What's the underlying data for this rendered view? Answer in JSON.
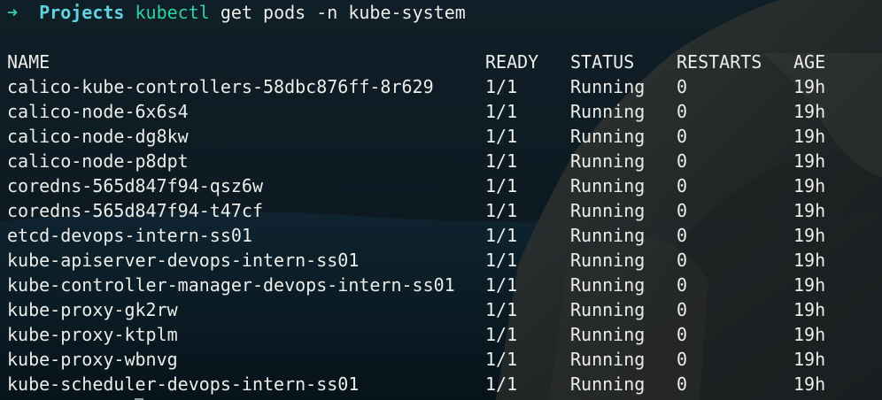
{
  "prompt": {
    "arrow": "➜",
    "directory": "Projects",
    "command": "kubectl",
    "args": "get pods -n kube-system"
  },
  "table": {
    "headers": {
      "name": "NAME",
      "ready": "READY",
      "status": "STATUS",
      "restarts": "RESTARTS",
      "age": "AGE"
    },
    "rows": [
      {
        "name": "calico-kube-controllers-58dbc876ff-8r629",
        "ready": "1/1",
        "status": "Running",
        "restarts": "0",
        "age": "19h"
      },
      {
        "name": "calico-node-6x6s4",
        "ready": "1/1",
        "status": "Running",
        "restarts": "0",
        "age": "19h"
      },
      {
        "name": "calico-node-dg8kw",
        "ready": "1/1",
        "status": "Running",
        "restarts": "0",
        "age": "19h"
      },
      {
        "name": "calico-node-p8dpt",
        "ready": "1/1",
        "status": "Running",
        "restarts": "0",
        "age": "19h"
      },
      {
        "name": "coredns-565d847f94-qsz6w",
        "ready": "1/1",
        "status": "Running",
        "restarts": "0",
        "age": "19h"
      },
      {
        "name": "coredns-565d847f94-t47cf",
        "ready": "1/1",
        "status": "Running",
        "restarts": "0",
        "age": "19h"
      },
      {
        "name": "etcd-devops-intern-ss01",
        "ready": "1/1",
        "status": "Running",
        "restarts": "0",
        "age": "19h"
      },
      {
        "name": "kube-apiserver-devops-intern-ss01",
        "ready": "1/1",
        "status": "Running",
        "restarts": "0",
        "age": "19h"
      },
      {
        "name": "kube-controller-manager-devops-intern-ss01",
        "ready": "1/1",
        "status": "Running",
        "restarts": "0",
        "age": "19h"
      },
      {
        "name": "kube-proxy-gk2rw",
        "ready": "1/1",
        "status": "Running",
        "restarts": "0",
        "age": "19h"
      },
      {
        "name": "kube-proxy-ktplm",
        "ready": "1/1",
        "status": "Running",
        "restarts": "0",
        "age": "19h"
      },
      {
        "name": "kube-proxy-wbnvg",
        "ready": "1/1",
        "status": "Running",
        "restarts": "0",
        "age": "19h"
      },
      {
        "name": "kube-scheduler-devops-intern-ss01",
        "ready": "1/1",
        "status": "Running",
        "restarts": "0",
        "age": "19h"
      }
    ]
  },
  "colors": {
    "prompt_arrow": "#2bd3a5",
    "directory": "#5fd4e0",
    "command": "#2bd3a5",
    "text": "#ecece8",
    "background": "#0c1a22"
  }
}
